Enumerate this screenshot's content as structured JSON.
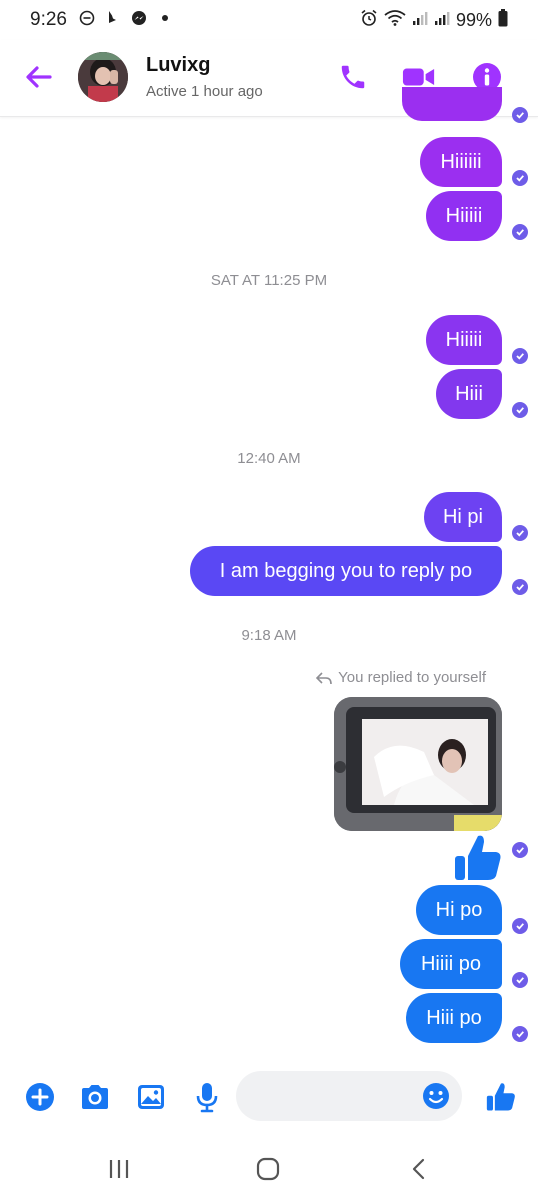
{
  "status_bar": {
    "time": "9:26",
    "battery": "99%",
    "left_icons": [
      "do-not-disturb-icon",
      "bing-icon",
      "messenger-icon",
      "dot-icon"
    ],
    "right_icons": [
      "alarm-icon",
      "wifi-icon",
      "signal-icon",
      "signal-icon",
      "battery-icon"
    ]
  },
  "header": {
    "contact_name": "Luvixg",
    "status": "Active 1 hour ago",
    "accent": "#a033ff",
    "icons": [
      "back-arrow-icon",
      "phone-icon",
      "video-icon",
      "info-icon"
    ]
  },
  "messages": {
    "group1": [
      "Hiiiiii",
      "Hiiiii"
    ],
    "timestamp1": "SAT AT 11:25 PM",
    "group2": [
      "Hiiiii",
      "Hiii"
    ],
    "timestamp2": "12:40 AM",
    "group3": [
      "Hi pi",
      "I am begging you to reply po"
    ],
    "timestamp3": "9:18 AM",
    "reply_note": "You replied to yourself",
    "group4": [
      "Hi po",
      "Hiiii po",
      "Hiii po"
    ],
    "bubble_colors": {
      "purple": "#8a2be2",
      "violet": "#6a3cf0",
      "blue": "#1877f2"
    }
  },
  "composer": {
    "placeholder": "",
    "icons": [
      "plus-icon",
      "camera-icon",
      "gallery-icon",
      "microphone-icon",
      "emoji-icon",
      "thumbs-up-icon"
    ]
  },
  "nav_bar": {
    "icons": [
      "recent-apps-icon",
      "home-icon",
      "back-icon"
    ]
  }
}
